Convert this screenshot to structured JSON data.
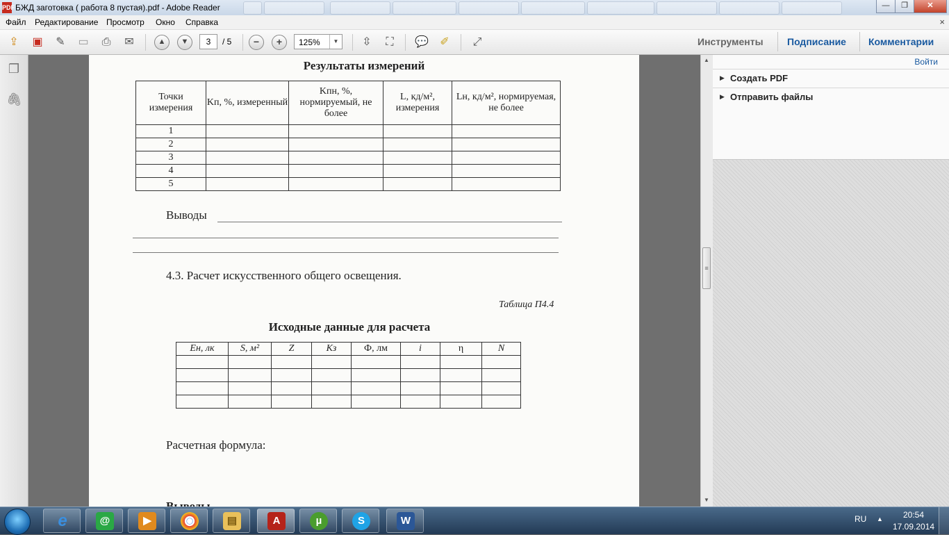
{
  "window": {
    "title": "БЖД заготовка ( работа 8 пустая).pdf - Adobe Reader",
    "title_icon": "PDF",
    "controls": {
      "minimize": "—",
      "maximize": "❐",
      "close": "✕"
    }
  },
  "menu": {
    "items": [
      "Файл",
      "Редактирование",
      "Просмотр",
      "Окно",
      "Справка"
    ],
    "close_glyph": "×"
  },
  "toolbar": {
    "page_current": "3",
    "page_total": "/ 5",
    "zoom": "125%",
    "zoom_out_glyph": "−",
    "zoom_in_glyph": "+",
    "tabs": [
      "Инструменты",
      "Подписание",
      "Комментарии"
    ]
  },
  "document": {
    "table1_title": "Результаты измерений",
    "table1": {
      "headers": [
        "Точки измерения",
        "Kп, %, измеренный",
        "Kпн, %, нормируемый, не более",
        "L, кд/м², измерения",
        "Lн, кд/м², нормируемая, не более"
      ],
      "rows": [
        "1",
        "2",
        "3",
        "4",
        "5"
      ]
    },
    "conclusions_label": "Выводы",
    "section_heading": "4.3. Расчет искусственного общего освещения.",
    "table_caption": "Таблица П4.4",
    "table2_title": "Исходные данные для расчета",
    "table2": {
      "headers": [
        "Eн, лк",
        "S, м²",
        "Z",
        "Kз",
        "Ф, лм",
        "i",
        "η",
        "N"
      ],
      "empty_rows": 4
    },
    "formula_label": "Расчетная формула:",
    "cut_text": "Выводы"
  },
  "right_pane": {
    "login": "Войти",
    "sections": [
      "Создать PDF",
      "Отправить файлы"
    ]
  },
  "taskbar": {
    "apps": [
      "internet-explorer",
      "mail-agent",
      "media-player",
      "chrome",
      "explorer",
      "adobe-reader",
      "utorrent",
      "skype",
      "word"
    ],
    "app_glyphs": {
      "ie": "e",
      "mail": "@",
      "media": "▶",
      "chrome": "◉",
      "explorer": "▤",
      "pdf": "A",
      "utorrent": "µ",
      "skype": "S",
      "word": "W"
    },
    "lang": "RU",
    "time": "20:54",
    "date": "17.09.2014"
  },
  "colors": {
    "accent_link": "#1a5aa0",
    "title_bar": "#c9d7e8",
    "pdf_red": "#c62b1f"
  }
}
